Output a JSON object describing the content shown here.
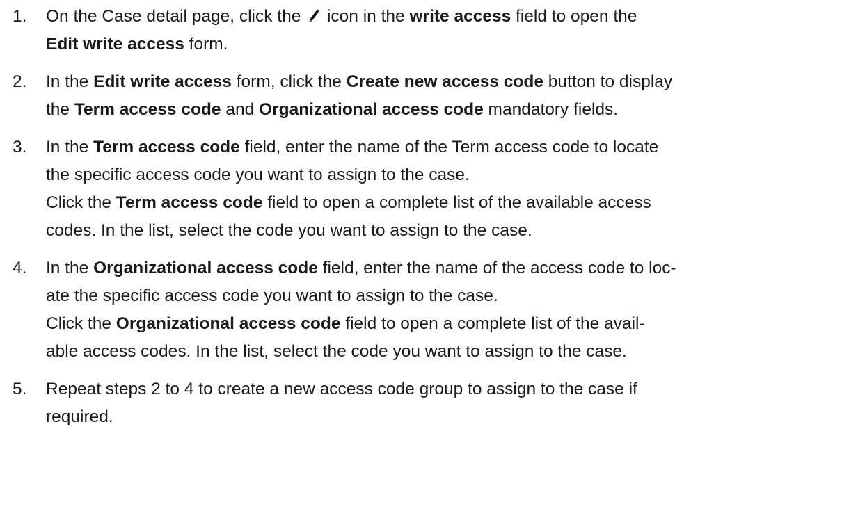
{
  "steps": [
    {
      "number": "1.",
      "lines": [
        [
          {
            "t": "On the Case detail page, click the "
          },
          {
            "icon": "pencil-icon"
          },
          {
            "t": " icon in the "
          },
          {
            "t": "write access",
            "b": true
          },
          {
            "t": " field to open the"
          }
        ],
        [
          {
            "t": "Edit write access",
            "b": true
          },
          {
            "t": " form."
          }
        ]
      ]
    },
    {
      "number": "2.",
      "lines": [
        [
          {
            "t": "In the "
          },
          {
            "t": "Edit write access",
            "b": true
          },
          {
            "t": " form, click the "
          },
          {
            "t": "Create new access code",
            "b": true
          },
          {
            "t": " button to display"
          }
        ],
        [
          {
            "t": "the "
          },
          {
            "t": "Term access code",
            "b": true
          },
          {
            "t": " and "
          },
          {
            "t": "Organizational access code",
            "b": true
          },
          {
            "t": " mandatory fields."
          }
        ]
      ]
    },
    {
      "number": "3.",
      "lines": [
        [
          {
            "t": "In the "
          },
          {
            "t": "Term access code",
            "b": true
          },
          {
            "t": " field, enter the name of the Term access code to locate"
          }
        ],
        [
          {
            "t": "the specific access code you want to assign to the case."
          }
        ],
        [
          {
            "t": "Click the "
          },
          {
            "t": "Term access code",
            "b": true
          },
          {
            "t": " field to open a complete list of the available access"
          }
        ],
        [
          {
            "t": "codes. In the list, select the code you want to assign to the case."
          }
        ]
      ]
    },
    {
      "number": "4.",
      "lines": [
        [
          {
            "t": "In the "
          },
          {
            "t": "Organizational access code",
            "b": true
          },
          {
            "t": " field, enter the name of the access code to loc-"
          }
        ],
        [
          {
            "t": "ate the specific access code you want to assign to the case."
          }
        ],
        [
          {
            "t": "Click the "
          },
          {
            "t": "Organizational access code",
            "b": true
          },
          {
            "t": " field to open a complete list of the avail-"
          }
        ],
        [
          {
            "t": "able access codes. In the list, select the code you want to assign to the case."
          }
        ]
      ]
    },
    {
      "number": "5.",
      "lines": [
        [
          {
            "t": "Repeat steps 2 to 4 to create a new access code group to assign to the case if"
          }
        ],
        [
          {
            "t": "required."
          }
        ]
      ]
    }
  ]
}
